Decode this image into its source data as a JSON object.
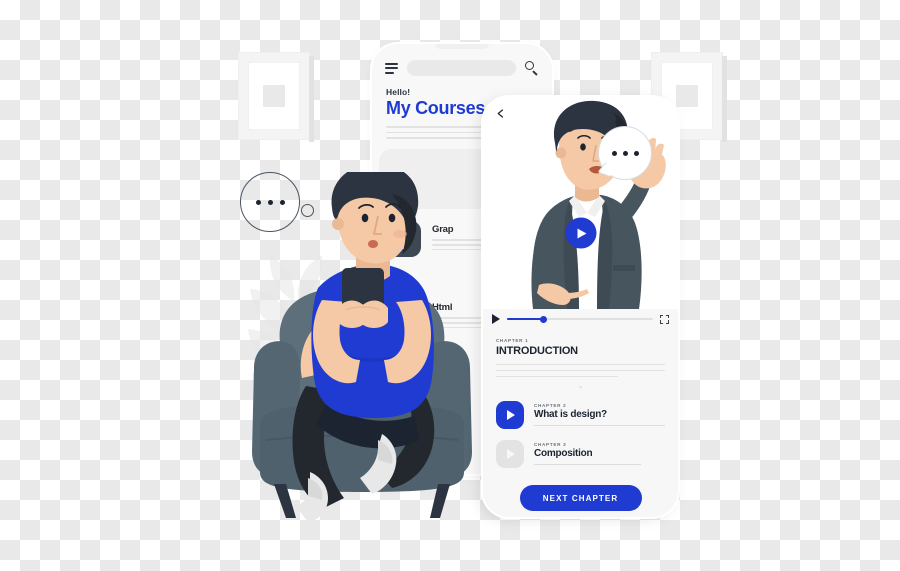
{
  "scene": {
    "title": "Online learning illustration",
    "subject": "Person sitting in armchair using phone with course app screens"
  },
  "colors": {
    "brand_blue": "#1f3bd1",
    "shirt_blue": "#1f3bd1",
    "chair_slate": "#5d6f7a",
    "dark_ink": "#1b2430",
    "panel_gray": "#f7f7f7",
    "line_gray": "#e2e2e2",
    "skin": "#f5c9a6",
    "hair_dark": "#2b3440",
    "suit_gray": "#47555f"
  },
  "back_phone": {
    "menu_icon": "hamburger-icon",
    "search_icon": "search-icon",
    "search_placeholder": "",
    "greeting": "Hello!",
    "title": "My Courses",
    "courses": [
      {
        "icon": "pen-tool-icon",
        "label": "Grap"
      },
      {
        "icon": "pen-tool-icon",
        "label": "Html"
      }
    ]
  },
  "front_phone": {
    "back_icon": "chevron-left-icon",
    "play_overlay_icon": "play-circle-icon",
    "speech_bubble_icon": "ellipsis-bubble-icon",
    "player": {
      "play_icon": "play-icon",
      "fullscreen_icon": "fullscreen-icon",
      "progress_percent": 25
    },
    "current": {
      "kicker": "CHAPTER 1",
      "title": "INTRODUCTION"
    },
    "chapters": [
      {
        "kicker": "CHAPTER 2",
        "title": "What is design?",
        "state": "active",
        "icon": "play-icon"
      },
      {
        "kicker": "CHAPTER 3",
        "title": "Composition",
        "state": "locked",
        "icon": "play-icon"
      }
    ],
    "next_button": "NEXT CHAPTER"
  },
  "decor": {
    "thought_bubble_icon": "ellipsis-bubble-icon",
    "frame_left_icon": "picture-frame-icon",
    "frame_right_icon": "picture-frame-icon",
    "plant_icon": "leaf-plant-icon",
    "chair_icon": "armchair-icon",
    "phone_in_hand_icon": "smartphone-icon"
  }
}
